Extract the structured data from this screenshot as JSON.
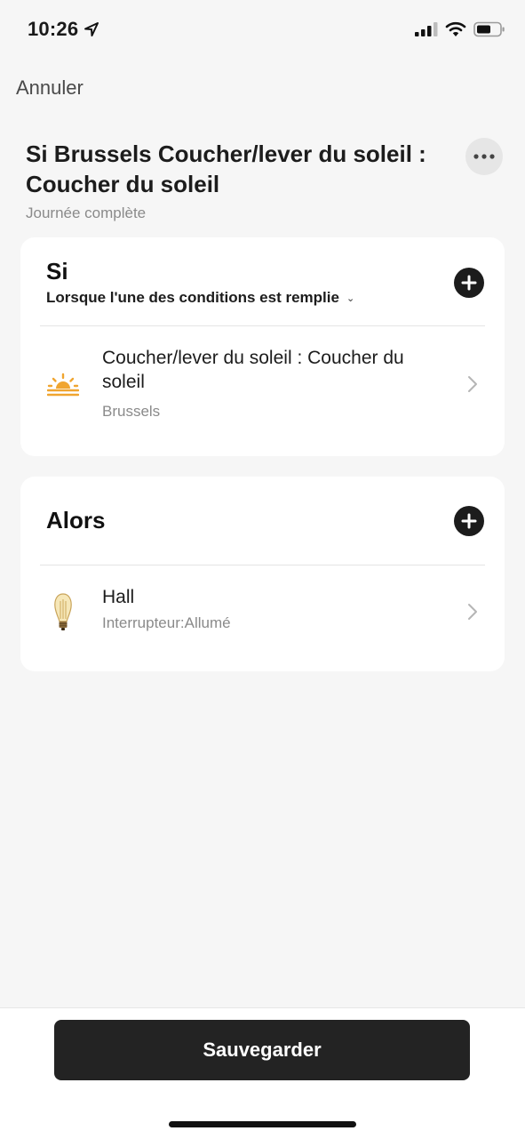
{
  "status_bar": {
    "time": "10:26"
  },
  "header": {
    "cancel_label": "Annuler",
    "title": "Si Brussels Coucher/lever du soleil : Coucher du soleil",
    "subtitle": "Journée complète"
  },
  "if_section": {
    "title": "Si",
    "condition_mode": "Lorsque l'une des conditions est remplie",
    "items": [
      {
        "title": "Coucher/lever du soleil : Coucher du soleil",
        "subtitle": "Brussels",
        "icon": "sunset-icon"
      }
    ]
  },
  "then_section": {
    "title": "Alors",
    "items": [
      {
        "title": "Hall",
        "subtitle": "Interrupteur:Allumé",
        "icon": "light-bulb-icon"
      }
    ]
  },
  "footer": {
    "save_label": "Sauvegarder"
  },
  "colors": {
    "accent_dark": "#232323",
    "sun": "#f0a530",
    "background": "#f6f6f6"
  }
}
